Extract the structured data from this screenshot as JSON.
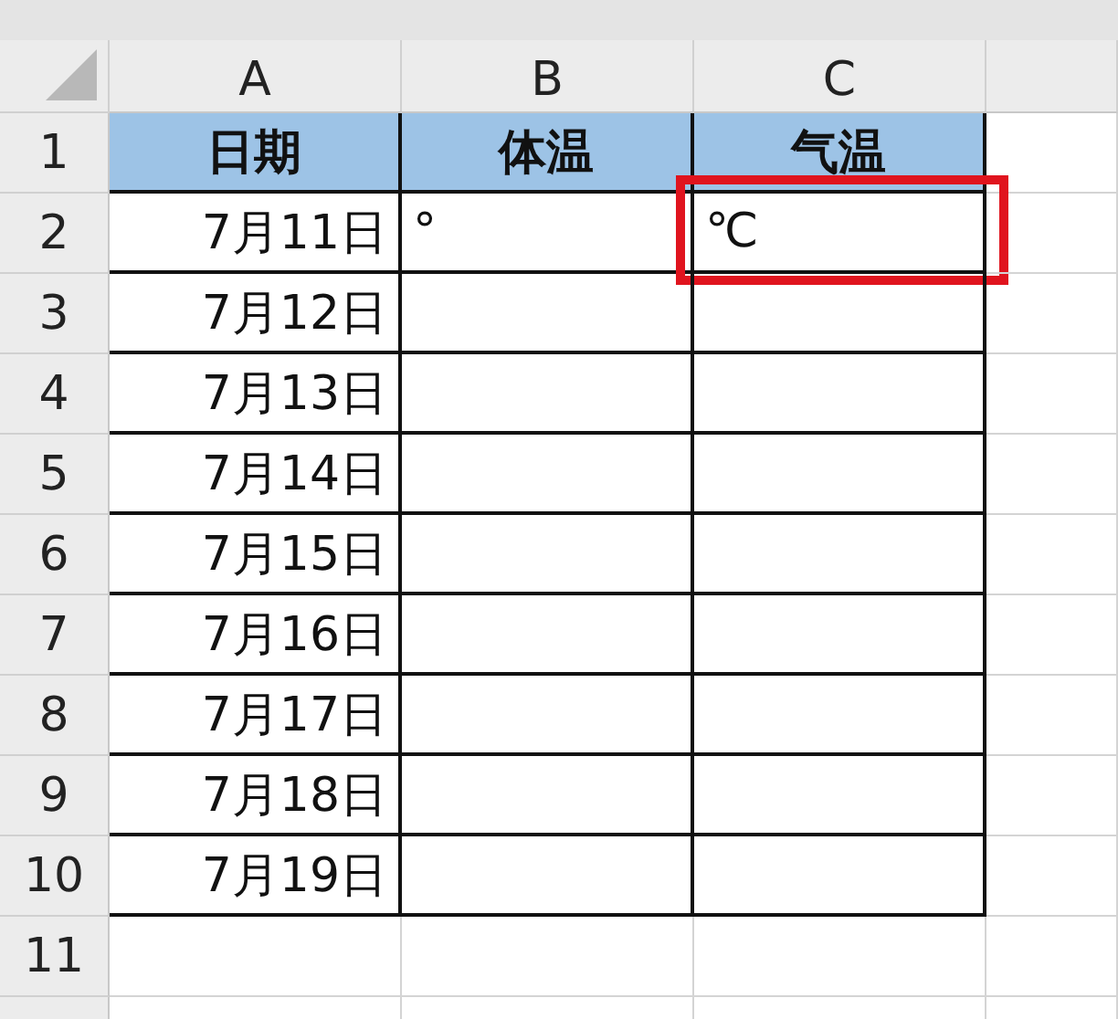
{
  "columns": [
    "A",
    "B",
    "C"
  ],
  "rows": [
    {
      "number": "1",
      "kind": "header",
      "cells": [
        {
          "text": "日期",
          "highlighted": false
        },
        {
          "text": "体温",
          "highlighted": false
        },
        {
          "text": "气温",
          "highlighted": false
        }
      ]
    },
    {
      "number": "2",
      "kind": "data",
      "cells": [
        {
          "text": "7月11日",
          "highlighted": false
        },
        {
          "text": "°",
          "highlighted": false
        },
        {
          "text": "℃",
          "highlighted": true
        }
      ]
    },
    {
      "number": "3",
      "kind": "data",
      "cells": [
        {
          "text": "7月12日",
          "highlighted": false
        },
        {
          "highlighted": false
        },
        {
          "highlighted": false
        }
      ]
    },
    {
      "number": "4",
      "kind": "data",
      "cells": [
        {
          "text": "7月13日",
          "highlighted": false
        },
        {
          "highlighted": false
        },
        {
          "highlighted": false
        }
      ]
    },
    {
      "number": "5",
      "kind": "data",
      "cells": [
        {
          "text": "7月14日",
          "highlighted": false
        },
        {
          "highlighted": false
        },
        {
          "highlighted": false
        }
      ]
    },
    {
      "number": "6",
      "kind": "data",
      "cells": [
        {
          "text": "7月15日",
          "highlighted": false
        },
        {
          "highlighted": false
        },
        {
          "highlighted": false
        }
      ]
    },
    {
      "number": "7",
      "kind": "data",
      "cells": [
        {
          "text": "7月16日",
          "highlighted": false
        },
        {
          "highlighted": false
        },
        {
          "highlighted": false
        }
      ]
    },
    {
      "number": "8",
      "kind": "data",
      "cells": [
        {
          "text": "7月17日",
          "highlighted": false
        },
        {
          "highlighted": false
        },
        {
          "highlighted": false
        }
      ]
    },
    {
      "number": "9",
      "kind": "data",
      "cells": [
        {
          "text": "7月18日",
          "highlighted": false
        },
        {
          "highlighted": false
        },
        {
          "highlighted": false
        }
      ]
    },
    {
      "number": "10",
      "kind": "data",
      "cells": [
        {
          "text": "7月19日",
          "highlighted": false
        },
        {
          "highlighted": false
        },
        {
          "highlighted": false
        }
      ]
    },
    {
      "number": "11",
      "kind": "blank",
      "cells": [
        {
          "highlighted": false
        },
        {
          "highlighted": false
        },
        {
          "highlighted": false
        }
      ]
    }
  ]
}
